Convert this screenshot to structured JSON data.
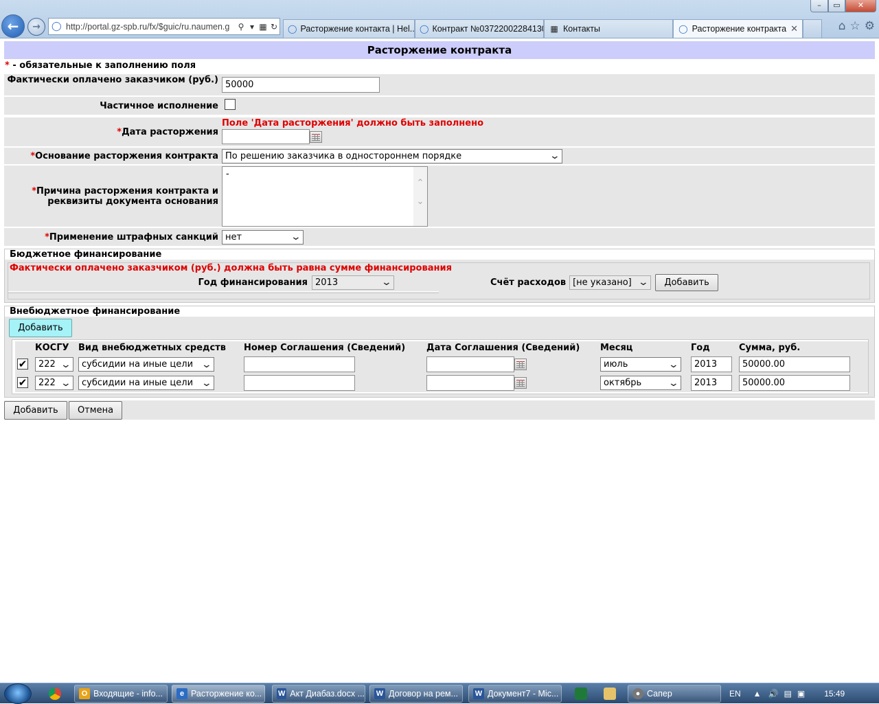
{
  "browser": {
    "url": "http://portal.gz-spb.ru/fx/$guic/ru.naumen.g",
    "tabs": [
      {
        "label": "Расторжение контакта | Hel...",
        "icon": "ie-icon"
      },
      {
        "label": "Контракт №03722002284130...",
        "icon": "ie-icon"
      },
      {
        "label": "Контакты",
        "icon": "page-icon"
      },
      {
        "label": "Расторжение контракта",
        "icon": "ie-icon",
        "active": true
      }
    ],
    "window_controls": {
      "minimize": "–",
      "maximize": "▭",
      "close": "✕"
    }
  },
  "form": {
    "title": "Расторжение контракта",
    "required_note_star": "*",
    "required_note": " - обязательные к заполнению поля",
    "paid_label": "Фактически оплачено заказчиком (руб.)",
    "paid_value": "50000",
    "partial_label": "Частичное исполнение",
    "partial_checked": false,
    "termination_date_label": "Дата расторжения",
    "termination_date_error": "Поле 'Дата расторжения' должно быть заполнено",
    "termination_date_value": "",
    "basis_label": "Основание расторжения контракта",
    "basis_value": "По решению заказчика в одностороннем порядке",
    "reason_label": "Причина расторжения контракта и реквизиты документа основания",
    "reason_value": "-",
    "penalty_label": "Применение штрафных санкций",
    "penalty_value": "нет",
    "required_star": "*"
  },
  "budget": {
    "legend": "Бюджетное финансирование",
    "error": "Фактически оплачено заказчиком (руб.) должна быть равна сумме финансирования",
    "year_label": "Год финансирования",
    "year_value": "2013",
    "account_label": "Счёт расходов",
    "account_value": "[не указано]",
    "add_label": "Добавить"
  },
  "extrabudget": {
    "legend": "Внебюджетное финансирование",
    "add_label": "Добавить",
    "columns": [
      "КОСГУ",
      "Вид внебюджетных средств",
      "Номер Соглашения (Сведений)",
      "Дата Соглашения (Сведений)",
      "Месяц",
      "Год",
      "Сумма, руб."
    ],
    "rows": [
      {
        "checked": true,
        "kosgu": "222",
        "type": "субсидии на иные цели",
        "number": "",
        "date": "",
        "month": "июль",
        "year": "2013",
        "sum": "50000.00"
      },
      {
        "checked": true,
        "kosgu": "222",
        "type": "субсидии на иные цели",
        "number": "",
        "date": "",
        "month": "октябрь",
        "year": "2013",
        "sum": "50000.00"
      }
    ]
  },
  "actions": {
    "add": "Добавить",
    "cancel": "Отмена"
  },
  "taskbar": {
    "items": [
      {
        "label": "Входящие - info...",
        "icon": "outlook-icon",
        "color": "#e8a317"
      },
      {
        "label": "Расторжение ко...",
        "icon": "ie-icon",
        "color": "#2b6cc4",
        "active": true
      },
      {
        "label": "Акт Диабаз.docx ...",
        "icon": "word-icon",
        "color": "#2a5699"
      },
      {
        "label": "Договор на рем...",
        "icon": "word-icon",
        "color": "#2a5699"
      },
      {
        "label": "Документ7 - Mic...",
        "icon": "word-icon",
        "color": "#2a5699"
      },
      {
        "label": "Сапер",
        "icon": "minesweeper-icon",
        "color": "#777777"
      }
    ],
    "lang": "EN",
    "time": "15:49"
  }
}
